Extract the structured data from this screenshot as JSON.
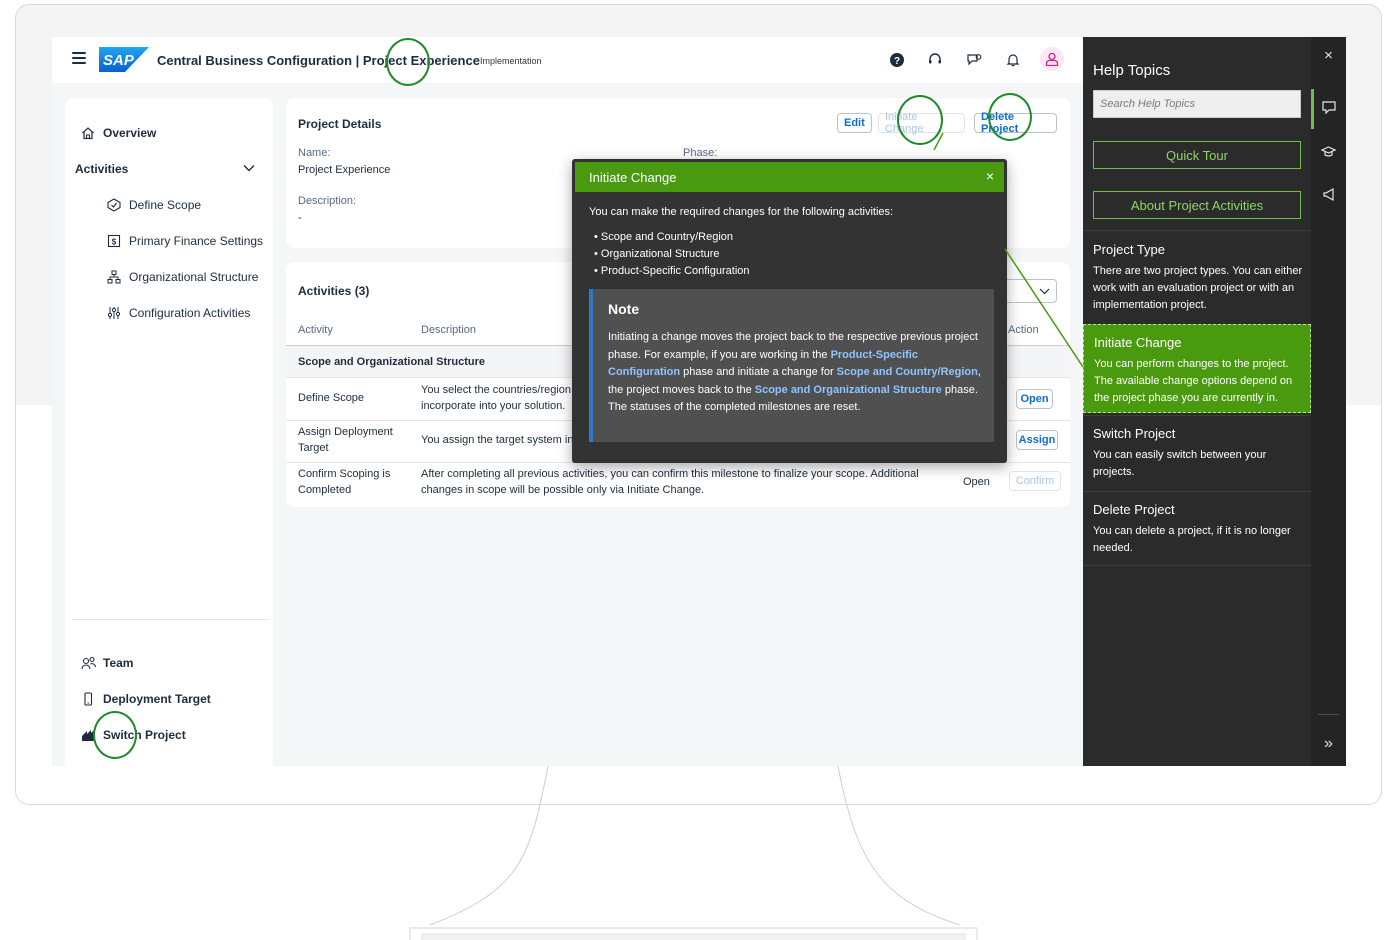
{
  "header": {
    "title": "Central Business Configuration | Project Experience",
    "subtitle": "Implementation",
    "logo_text": "SAP"
  },
  "sidenav": {
    "overview": "Overview",
    "activities": "Activities",
    "items": [
      {
        "label": "Define Scope"
      },
      {
        "label": "Primary Finance Settings"
      },
      {
        "label": "Organizational Structure"
      },
      {
        "label": "Configuration Activities"
      }
    ],
    "team": "Team",
    "deployment_target": "Deployment Target",
    "switch_project": "Switch Project"
  },
  "project_details": {
    "title": "Project Details",
    "edit": "Edit",
    "initiate_change": "Initiate Change",
    "delete_project": "Delete Project",
    "name_label": "Name:",
    "name_value": "Project Experience",
    "phase_label": "Phase:",
    "description_label": "Description:",
    "description_value": "-"
  },
  "activities": {
    "title": "Activities (3)",
    "columns": {
      "activity": "Activity",
      "description": "Description",
      "action": "Action"
    },
    "group": "Scope and Organizational Structure",
    "rows": [
      {
        "activity": "Define Scope",
        "description": "You select the countries/region",
        "description2": "incorporate into your solution.",
        "status": "",
        "action": "Open"
      },
      {
        "activity": "Assign Deployment",
        "activity2": "Target",
        "description": "You assign the target system in",
        "status": "",
        "action": "Assign"
      },
      {
        "activity": "Confirm Scoping is",
        "activity2": "Completed",
        "description": "After completing all previous activities, you can confirm this milestone to finalize your scope. Additional",
        "description2": "changes in scope will be possible only via Initiate Change.",
        "status": "Open",
        "action": "Confirm"
      }
    ]
  },
  "popover": {
    "title": "Initiate Change",
    "close": "×",
    "intro": "You can make the required changes for the following activities:",
    "bullets": [
      "Scope and Country/Region",
      "Organizational Structure",
      "Product-Specific Configuration"
    ],
    "note_title": "Note",
    "note": {
      "p1": "Initiating a change moves the project back to the respective previous project phase. For example, if you are working in the ",
      "h1": "Product-Specific Configuration",
      "p2": " phase and initiate a change for ",
      "h2": "Scope and Country/Region",
      "p3": ", the project moves back to the ",
      "h3": "Scope and Organizational Structure",
      "p4": " phase. The statuses of the completed milestones are reset."
    }
  },
  "help": {
    "title": "Help Topics",
    "search_placeholder": "Search Help Topics",
    "quick_tour": "Quick Tour",
    "about": "About Project Activities",
    "topics": [
      {
        "title": "Project Type",
        "desc": "There are two project types. You can either work with an evaluation project or with an implementation project."
      },
      {
        "title": "Initiate Change",
        "desc": "You can perform changes to the project. The available change options depend on the project phase you are currently in."
      },
      {
        "title": "Switch Project",
        "desc": "You can easily switch between your projects."
      },
      {
        "title": "Delete Project",
        "desc": "You can delete a project, if it is no longer needed."
      }
    ],
    "close": "×",
    "expand": "»"
  },
  "colors": {
    "accent_green": "#4a9a10",
    "link_blue": "#0a6ed1",
    "ring_green": "#1f8a2b"
  }
}
